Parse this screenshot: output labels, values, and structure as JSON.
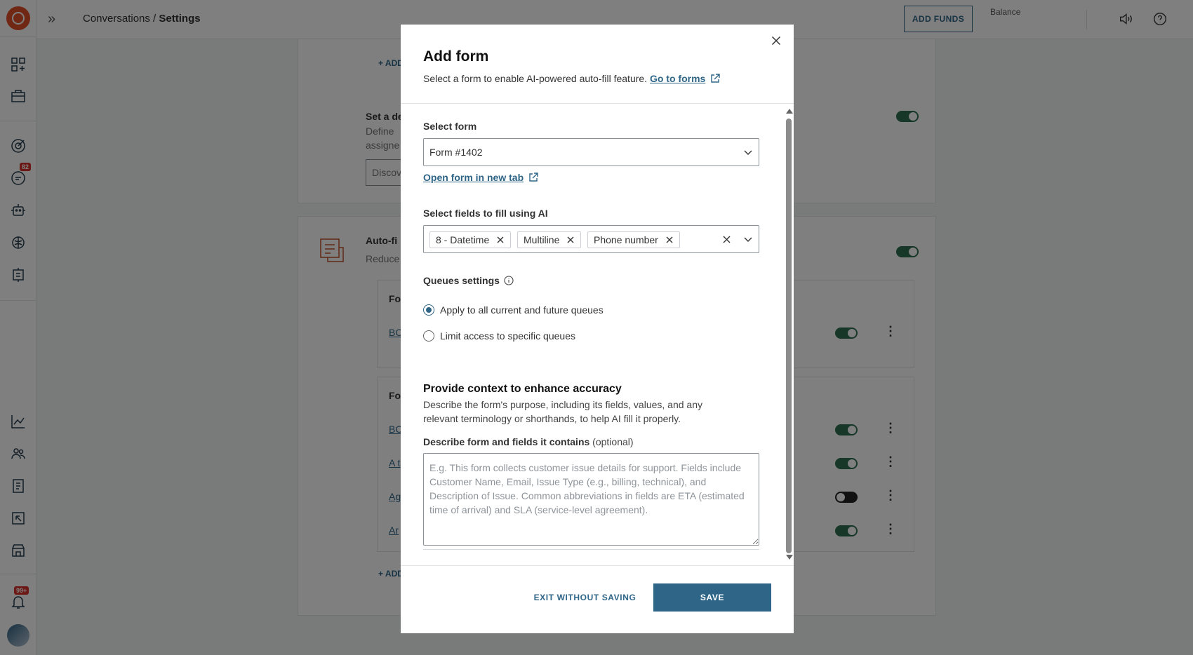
{
  "app": {
    "breadcrumb_parent": "Conversations",
    "breadcrumb_separator": " / ",
    "breadcrumb_current": "Settings",
    "add_funds_label": "ADD FUNDS",
    "balance_label": "Balance",
    "conversations_badge": "82",
    "notifications_badge": "99+"
  },
  "background": {
    "add_link_1": "+ ADD",
    "set_default_title": "Set a de",
    "set_default_desc_1": "Define",
    "set_default_desc_2": "assigne",
    "discover_input": "Discov",
    "auto_fill_title": "Auto-fi",
    "auto_fill_desc": "Reduce",
    "table1_header": "Fo",
    "table1_row1": "BC",
    "table2_header": "Fo",
    "table2_rows": [
      "BC",
      "A t",
      "Ag",
      "Ar"
    ],
    "add_link_2": "+ ADD"
  },
  "modal": {
    "title": "Add form",
    "subtitle": "Select a form to enable AI-powered auto-fill feature.",
    "go_to_forms": "Go to forms",
    "select_form_label": "Select form",
    "selected_form": "Form #1402",
    "open_form_link": "Open form in new tab",
    "select_fields_label": "Select fields to fill using AI",
    "selected_fields": [
      "8 - Datetime",
      "Multiline",
      "Phone number"
    ],
    "queues_label": "Queues settings",
    "queue_options": [
      {
        "label": "Apply to all current and future queues",
        "checked": true
      },
      {
        "label": "Limit access to specific queues",
        "checked": false
      }
    ],
    "context_title": "Provide context to enhance accuracy",
    "context_desc": "Describe the form's purpose, including its fields, values, and any relevant terminology or shorthands, to help AI fill it properly.",
    "describe_label": "Describe form and fields it contains",
    "describe_optional": "(optional)",
    "describe_placeholder": "E.g. This form collects customer issue details for support. Fields include Customer Name, Email, Issue Type (e.g., billing, technical), and Description of Issue. Common abbreviations in fields are ETA (estimated time of arrival) and SLA (service-level agreement).",
    "exit_label": "EXIT WITHOUT SAVING",
    "save_label": "SAVE"
  },
  "colors": {
    "accent": "#2f6688",
    "brand": "#e0502a",
    "toggle_on": "#2e6e52"
  }
}
